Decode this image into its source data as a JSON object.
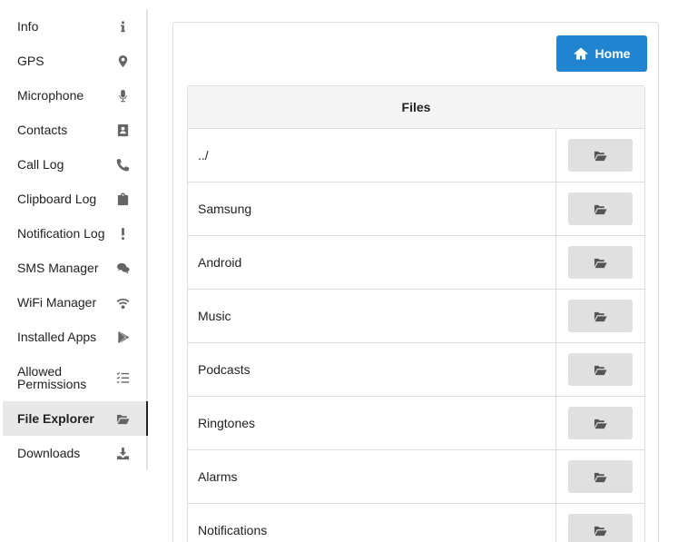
{
  "sidebar": {
    "items": [
      {
        "label": "Info",
        "icon": "info-icon"
      },
      {
        "label": "GPS",
        "icon": "map-marker-icon"
      },
      {
        "label": "Microphone",
        "icon": "microphone-icon"
      },
      {
        "label": "Contacts",
        "icon": "address-book-icon"
      },
      {
        "label": "Call Log",
        "icon": "phone-icon"
      },
      {
        "label": "Clipboard Log",
        "icon": "clipboard-icon"
      },
      {
        "label": "Notification Log",
        "icon": "exclamation-icon"
      },
      {
        "label": "SMS Manager",
        "icon": "comments-icon"
      },
      {
        "label": "WiFi Manager",
        "icon": "wifi-icon"
      },
      {
        "label": "Installed Apps",
        "icon": "play-store-icon"
      },
      {
        "label": "Allowed\nPermissions",
        "icon": "checklist-icon"
      },
      {
        "label": "File Explorer",
        "icon": "folder-open-icon"
      },
      {
        "label": "Downloads",
        "icon": "download-icon"
      }
    ],
    "active": "File Explorer"
  },
  "toolbar": {
    "home_label": "Home",
    "home_icon": "home-icon"
  },
  "files": {
    "header": "Files",
    "rows": [
      {
        "name": "../"
      },
      {
        "name": "Samsung"
      },
      {
        "name": "Android"
      },
      {
        "name": "Music"
      },
      {
        "name": "Podcasts"
      },
      {
        "name": "Ringtones"
      },
      {
        "name": "Alarms"
      },
      {
        "name": "Notifications"
      }
    ],
    "row_action_icon": "folder-open-icon"
  },
  "colors": {
    "accent": "#2184d0",
    "active_bg": "#e8e8e8",
    "button_gray": "#e0e0e0"
  }
}
